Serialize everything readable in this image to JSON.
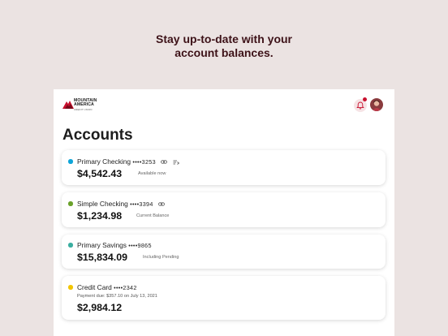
{
  "promo": {
    "line1": "Stay up-to-date with your",
    "line2": "account balances."
  },
  "header": {
    "logo_text": "MOUNTAIN\nAMERICA",
    "logo_subtext": "CREDIT UNION"
  },
  "page_title": "Accounts",
  "accounts": [
    {
      "name": "Primary Checking",
      "mask": "••••3253",
      "balance": "$4,542.43",
      "balance_label": "Available now",
      "dot_color": "#0ea5d8",
      "icons": [
        "link-icon",
        "transfer-icon"
      ]
    },
    {
      "name": "Simple Checking",
      "mask": "••••3394",
      "balance": "$1,234.98",
      "balance_label": "Current Balance",
      "dot_color": "#6aa12a",
      "icons": [
        "link-icon"
      ]
    },
    {
      "name": "Primary Savings",
      "mask": "••••9865",
      "balance": "$15,834.09",
      "balance_label": "Including Pending",
      "dot_color": "#3aaea0",
      "icons": []
    },
    {
      "name": "Credit Card",
      "mask": "••••2342",
      "payment_due": "Payment due: $357.10 on July 13, 2021",
      "balance": "$2,984.12",
      "dot_color": "#f2c500",
      "icons": []
    }
  ],
  "colors": {
    "background": "#ebe3e2",
    "brand": "#c8102e",
    "promo_text": "#3d1218"
  }
}
